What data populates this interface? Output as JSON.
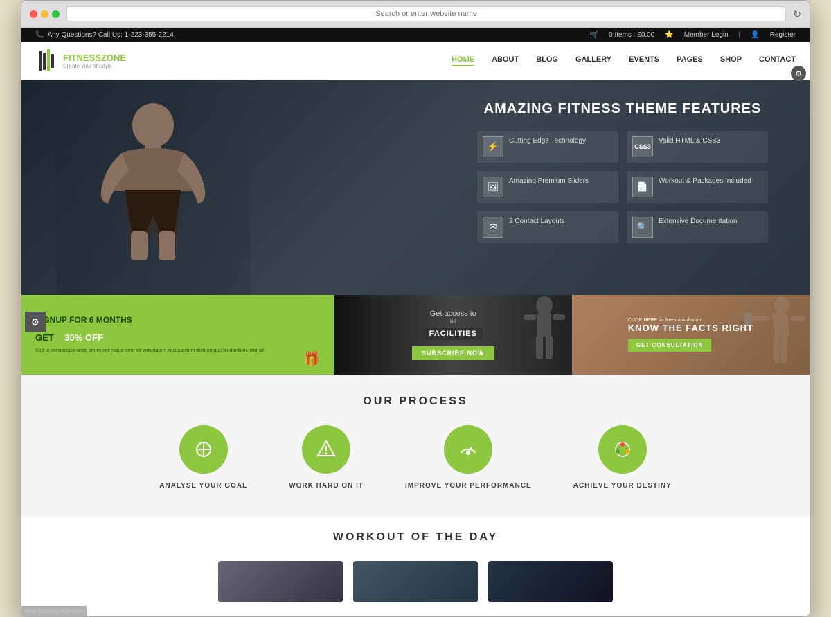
{
  "browser": {
    "address_bar_text": "Search or enter website name",
    "reload_icon": "↻"
  },
  "topbar": {
    "phone_icon": "📞",
    "phone_text": "Any Questions? Call Us: 1-223-355-2214",
    "cart_icon": "🛒",
    "cart_text": "0 Items : £0.00",
    "member_icon": "⭐",
    "member_text": "Member Login",
    "register_icon": "👤",
    "register_text": "Register"
  },
  "nav": {
    "logo_name": "FITNESS",
    "logo_name2": "ZONE",
    "logo_sub": "Create your lifestyle",
    "links": [
      "HOME",
      "ABOUT",
      "BLOG",
      "GALLERY",
      "EVENTS",
      "PAGES",
      "SHOP",
      "CONTACT"
    ],
    "active_link": "HOME"
  },
  "hero": {
    "title": "AMAZING FITNESS THEME FEATURES",
    "features": [
      {
        "icon": "⚡",
        "text": "Cutting Edge Technology"
      },
      {
        "icon": "5",
        "text": "Valid HTML & CSS3"
      },
      {
        "icon": "🖼",
        "text": "Amazing Premium Sliders"
      },
      {
        "icon": "📄",
        "text": "Workout & Packages Included"
      },
      {
        "icon": "✉",
        "text": "2 Contact Layouts"
      },
      {
        "icon": "🔍",
        "text": "Extensive Documentation"
      }
    ]
  },
  "promo": {
    "left": {
      "title": "SIGNUP FOR 6 MONTHS",
      "discount": "30% OFF",
      "discount_prefix": "GET",
      "body_text": "Sed ut perspiciatis unde omnis iste natus error sit voluptatem accusantium doloremque laudantium. olor sit.",
      "gift_icon": "🎁"
    },
    "middle": {
      "pre_text": "Get access to",
      "all_text": "all",
      "badge_text": "FACILITIES",
      "subscribe_text": "SUBSCRIBE NOW"
    },
    "right": {
      "click_text": "CLICK HERE for free consultation",
      "headline": "KNOW THE FACTS RIGHT",
      "cta": "GET CONSULTATION"
    }
  },
  "process": {
    "title": "OUR PROCESS",
    "items": [
      {
        "icon": "📏",
        "label": "ANALYSE YOUR GOAL"
      },
      {
        "icon": "△",
        "label": "WORK HARD ON IT"
      },
      {
        "icon": "⏱",
        "label": "IMPROVE YOUR PERFORMANCE"
      },
      {
        "icon": "🚦",
        "label": "ACHIEVE YOUR DESTINY"
      }
    ]
  },
  "workout": {
    "title": "WORKOUT OF THE DAY"
  },
  "settings": {
    "gear_icon": "⚙"
  },
  "watermark": {
    "text": "www.themesjungle.com"
  }
}
